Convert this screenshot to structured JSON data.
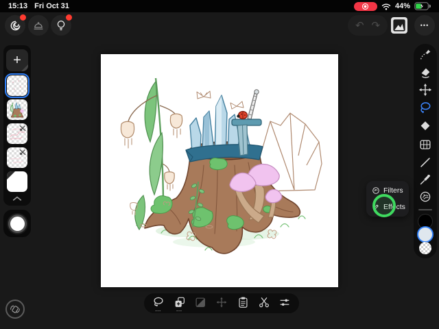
{
  "status_bar": {
    "time": "15:13",
    "date": "Fri Oct 31",
    "battery_percent": "44%"
  },
  "top_toolbar": {
    "undo_glyph": "↶",
    "redo_glyph": "↷",
    "more_glyph": "•••",
    "buttons": [
      {
        "icon": "gallery-spiral-icon",
        "badge": true
      },
      {
        "icon": "service-bell-icon",
        "badge": true,
        "disabled": true
      },
      {
        "icon": "ideas-bulb-icon",
        "badge": true
      },
      {
        "icon": "undo-icon",
        "disabled": true
      },
      {
        "icon": "redo-icon",
        "disabled": true
      },
      {
        "icon": "import-image-icon"
      },
      {
        "icon": "more-icon"
      }
    ]
  },
  "layers_panel": {
    "add_layer_glyph": "+",
    "layers": [
      {
        "kind": "transparent sketch layer",
        "selected": true,
        "hidden": false
      },
      {
        "kind": "colored artwork layer",
        "selected": false,
        "hidden": false
      },
      {
        "kind": "pink lineart layer",
        "selected": false,
        "hidden": true
      },
      {
        "kind": "pink rough sketch layer",
        "selected": false,
        "hidden": true
      },
      {
        "kind": "white background layer",
        "selected": false,
        "hidden": false
      }
    ]
  },
  "tool_sidebar": {
    "tools": [
      "draw",
      "eraser",
      "move",
      "lasso-select",
      "fill",
      "transform-grid",
      "line",
      "eyedropper",
      "effects"
    ],
    "active_tool": "lasso-select",
    "swatches": [
      {
        "name": "secondary-color",
        "value": "#000000"
      },
      {
        "name": "primary-color",
        "value": "#dfe7ee",
        "selected": true
      },
      {
        "name": "transparent-color",
        "value": "checkerboard"
      }
    ]
  },
  "context_menu": {
    "items": [
      {
        "icon": "filters-icon",
        "label": "Filters"
      },
      {
        "icon": "effects-icon",
        "label": "Effects"
      }
    ],
    "touch_indicator_on": "Effects"
  },
  "bottom_toolbar": {
    "more_glyph": "…",
    "items": [
      {
        "icon": "lasso-select-icon",
        "has_more": true
      },
      {
        "icon": "duplicate-icon",
        "has_more": true
      },
      {
        "icon": "fill-selection-icon",
        "disabled": true
      },
      {
        "icon": "move-selection-icon",
        "disabled": true
      },
      {
        "icon": "paste-icon"
      },
      {
        "icon": "cut-scissors-icon"
      },
      {
        "icon": "selection-settings-icon"
      }
    ]
  },
  "colors": {
    "accent_blue": "#2f7ff7",
    "touch_indicator_green": "#3fd95f",
    "badge_red": "#ff3b30",
    "battery_green": "#32d74b",
    "record_red": "#f23545",
    "canvas_bg": "#ffffff",
    "panel_bg": "#0e0e0e",
    "workspace_bg": "#191919"
  }
}
